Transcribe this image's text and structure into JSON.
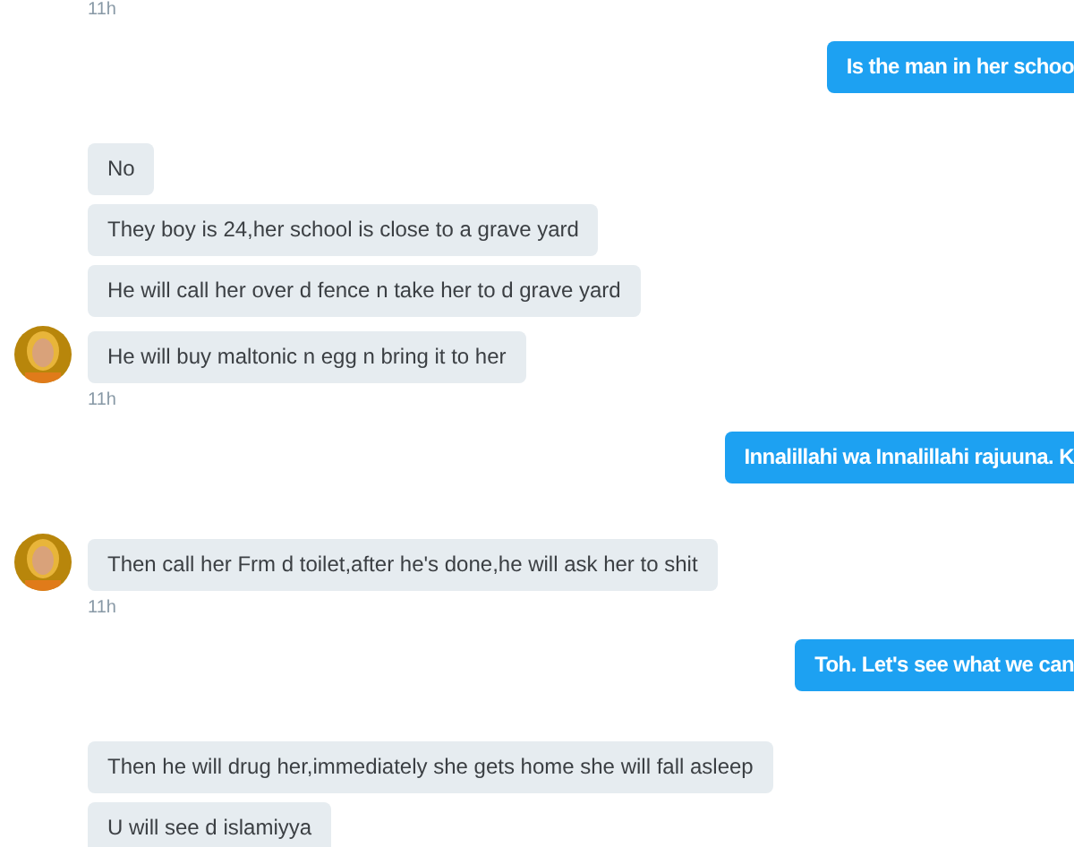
{
  "conversation": [
    {
      "kind": "time",
      "text": "11h"
    },
    {
      "kind": "outgoing",
      "text": "Is the man in her schoo"
    },
    {
      "kind": "incoming",
      "avatar": true,
      "time": "11h",
      "messages": [
        "No",
        "They boy is 24,her school is close to a grave yard",
        "He will call her over d fence n take her to d grave yard",
        "He will buy maltonic n egg n bring it to her"
      ]
    },
    {
      "kind": "outgoing",
      "text": "Innalillahi wa Innalillahi rajuuna. K"
    },
    {
      "kind": "incoming",
      "avatar": true,
      "time": "11h",
      "messages": [
        "Then call her Frm d toilet,after he's done,he will ask her to shit"
      ]
    },
    {
      "kind": "outgoing",
      "text": "Toh. Let's see what we can"
    },
    {
      "kind": "incoming",
      "avatar": false,
      "messages": [
        "Then he will drug her,immediately she gets home she will fall asleep",
        "U will see d islamiyya"
      ]
    }
  ]
}
